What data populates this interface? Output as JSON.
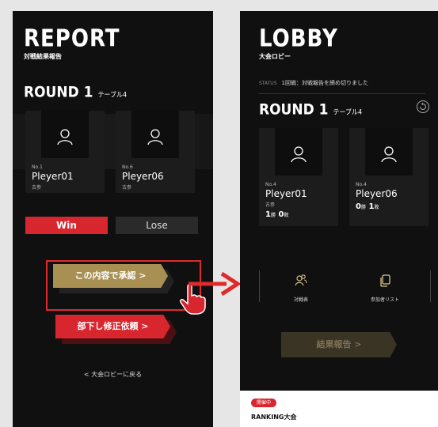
{
  "report": {
    "title": "REPORT",
    "subtitle": "対戦結果報告",
    "round": "ROUND 1",
    "table": "テーブル4",
    "players": [
      {
        "no": "No.1",
        "name": "Pleyer01",
        "grade": "古参"
      },
      {
        "no": "No.6",
        "name": "Pleyer06",
        "grade": "古参"
      }
    ],
    "win_label": "Win",
    "lose_label": "Lose",
    "approve_label": "この内容で承認 >",
    "fix_label": "部下し修正依頼 >",
    "back_label": "< 大会ロビーに戻る"
  },
  "lobby": {
    "title": "LOBBY",
    "subtitle": "大会ロビー",
    "status_label": "STATUS",
    "status_text": "1回戦：対戦報告を締め切りました",
    "round": "ROUND 1",
    "table": "テーブル4",
    "players": [
      {
        "no": "No.4",
        "name": "Pleyer01",
        "grade": "古参",
        "score_a": "1",
        "score_a_unit": "勝",
        "score_b": "0",
        "score_b_unit": "敗"
      },
      {
        "no": "No.4",
        "name": "Pleyer06",
        "grade": "",
        "score_a": "0",
        "score_a_unit": "勝",
        "score_b": "1",
        "score_b_unit": "敗"
      }
    ],
    "menu": [
      {
        "label": "対戦表",
        "icon": "people-icon"
      },
      {
        "label": "参加者リスト",
        "icon": "copy-icon"
      }
    ],
    "report_label": "結果報告 >",
    "badge": "開催中",
    "tournament": "RANKING大会"
  },
  "colors": {
    "red": "#d8262f",
    "gold": "#a89052",
    "dark": "#101010"
  }
}
